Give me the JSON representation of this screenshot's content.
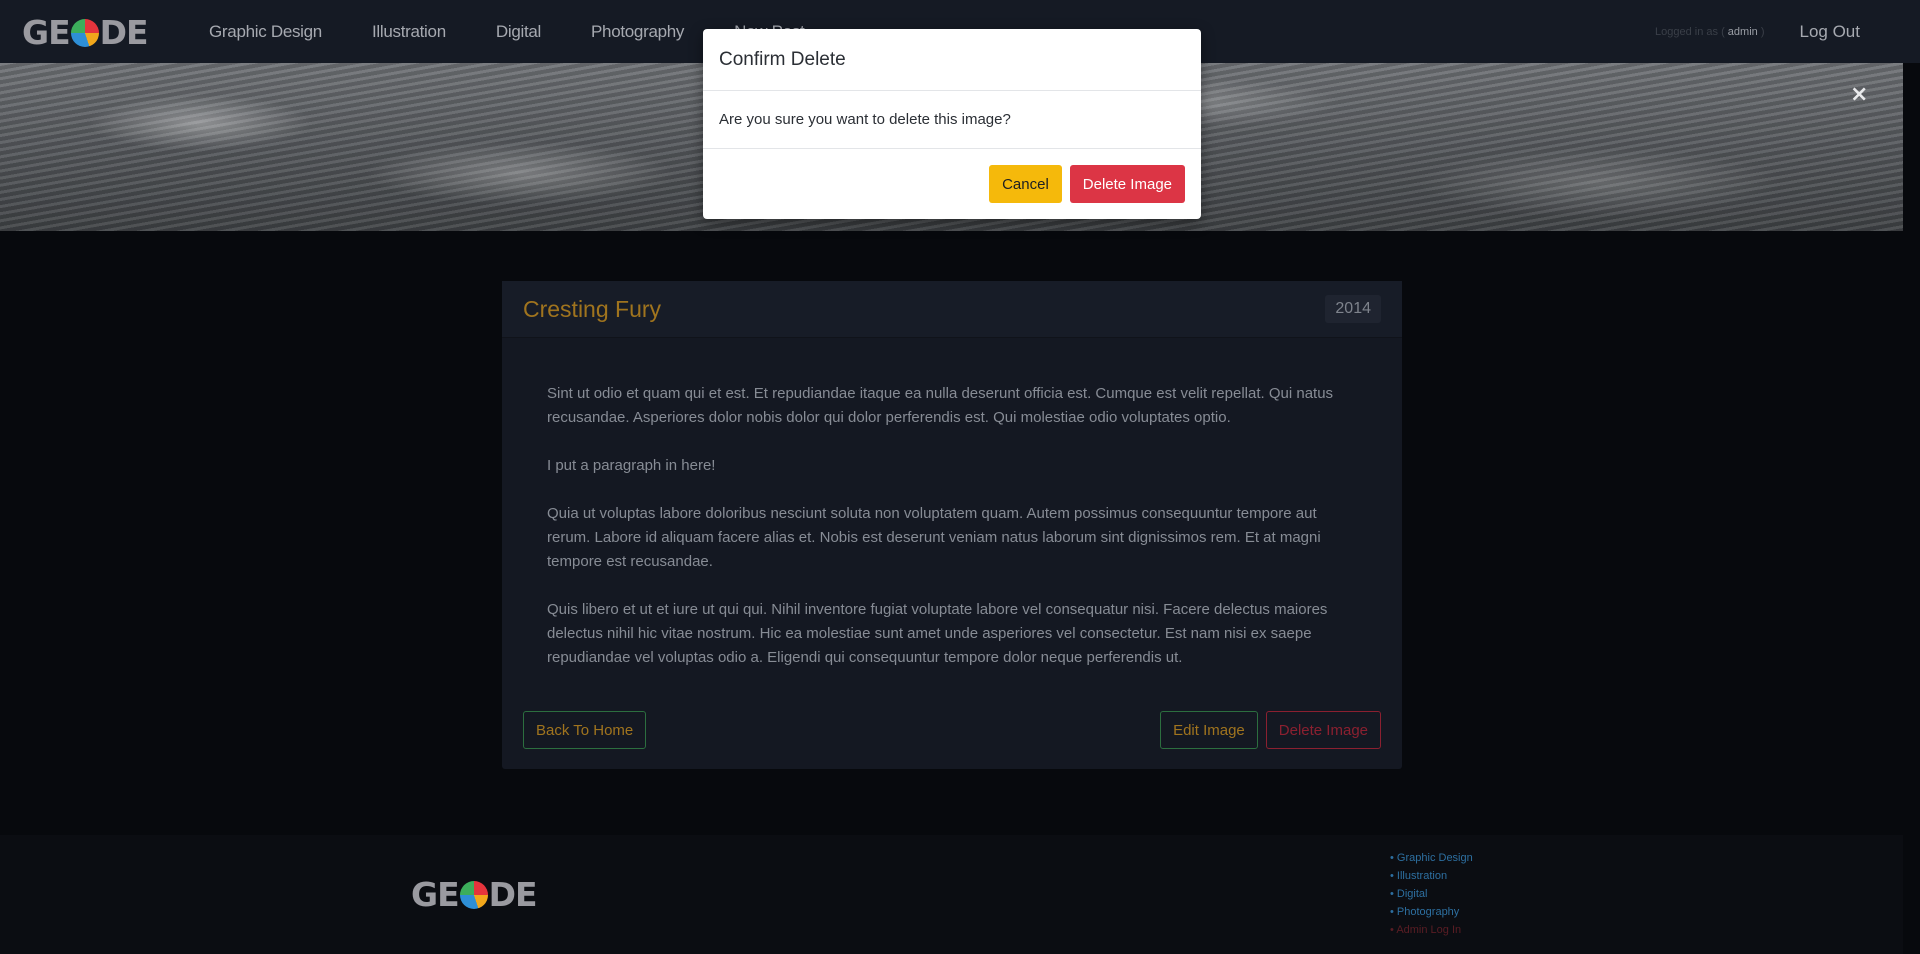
{
  "header": {
    "logo_text": [
      "GE",
      "DE"
    ],
    "nav": [
      "Graphic Design",
      "Illustration",
      "Digital",
      "Photography",
      "New Post"
    ],
    "logged_in_label": "Logged in as (",
    "logged_in_user": "admin",
    "logged_in_close": ")",
    "logout": "Log Out"
  },
  "hero": {
    "close_glyph": "×"
  },
  "post": {
    "title": "Cresting Fury",
    "year": "2014",
    "paragraphs": [
      "Sint ut odio et quam qui et est. Et repudiandae itaque ea nulla deserunt officia est. Cumque est velit repellat. Qui natus recusandae. Asperiores dolor nobis dolor qui dolor perferendis est. Qui molestiae odio voluptates optio.",
      "I put a paragraph in here!",
      "Quia ut voluptas labore doloribus nesciunt soluta non voluptatem quam. Autem possimus consequuntur tempore aut rerum. Labore id aliquam facere alias et. Nobis est deserunt veniam natus laborum sint dignissimos rem. Et at magni tempore est recusandae.",
      "Quis libero et ut et iure ut qui qui. Nihil inventore fugiat voluptate labore vel consequatur nisi. Facere delectus maiores delectus nihil hic vitae nostrum. Hic ea molestiae sunt amet unde asperiores vel consectetur. Est nam nisi ex saepe repudiandae vel voluptas odio a. Eligendi qui consequuntur tempore dolor neque perferendis ut."
    ],
    "back_label": "Back To Home",
    "edit_label": "Edit Image",
    "delete_label": "Delete Image"
  },
  "footer": {
    "links": [
      "Graphic Design",
      "Illustration",
      "Digital",
      "Photography",
      "Admin Log In"
    ]
  },
  "modal": {
    "title": "Confirm Delete",
    "message": "Are you sure you want to delete this image?",
    "cancel_label": "Cancel",
    "delete_label": "Delete Image"
  },
  "colors": {
    "accent_gold": "#a0741e",
    "danger": "#dc3545",
    "warning": "#f5b90b",
    "link_blue": "#2d6fa0"
  }
}
